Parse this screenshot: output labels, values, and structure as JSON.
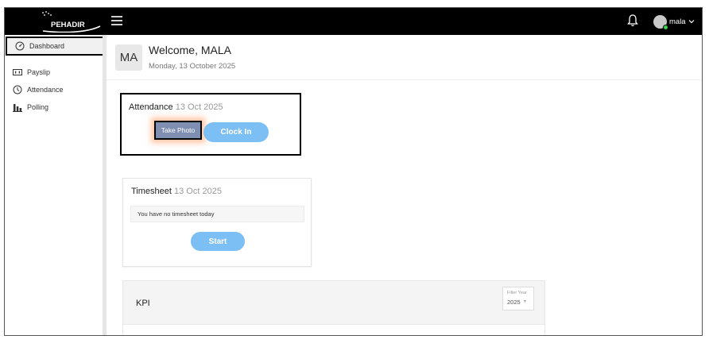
{
  "app": {
    "logo_text": "PEHADIR",
    "user_name": "mala"
  },
  "sidebar": {
    "items": [
      {
        "label": "Dashboard",
        "icon": "dashboard-icon"
      },
      {
        "label": "Payslip",
        "icon": "payslip-icon"
      },
      {
        "label": "Attendance",
        "icon": "clock-icon"
      },
      {
        "label": "Polling",
        "icon": "bar-chart-icon"
      }
    ]
  },
  "welcome": {
    "initials": "MA",
    "title": "Welcome, MALA",
    "date": "Monday, 13 October 2025"
  },
  "attendance": {
    "title": "Attendance",
    "date": "13 Oct 2025",
    "take_photo_label": "Take Photo",
    "clock_in_label": "Clock In"
  },
  "timesheet": {
    "title": "Timesheet",
    "date": "13 Oct 2025",
    "message": "You have no timesheet today",
    "start_label": "Start"
  },
  "kpi": {
    "title": "KPI",
    "filter_label": "Filter Year",
    "filter_value": "2025"
  },
  "colors": {
    "topbar": "#000000",
    "accent_button": "#7cbff4",
    "status_online": "#3ecf4c"
  }
}
